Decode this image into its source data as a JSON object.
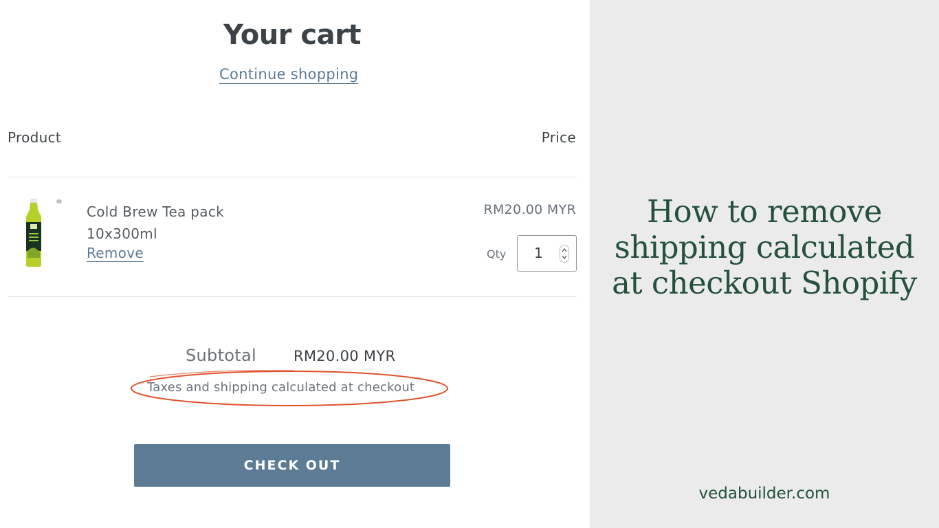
{
  "cart": {
    "title": "Your cart",
    "continue_label": "Continue shopping",
    "columns": {
      "product": "Product",
      "price": "Price"
    },
    "item": {
      "title_line1": "Cold Brew Tea pack",
      "title_line2": "10x300ml",
      "remove_label": "Remove",
      "price": "RM20.00 MYR",
      "qty_label": "Qty",
      "qty_value": "1"
    },
    "subtotal_label": "Subtotal",
    "subtotal_value": "RM20.00 MYR",
    "tax_note": "Taxes and shipping calculated at checkout",
    "checkout_label": "CHECK OUT"
  },
  "side": {
    "headline_line1": "How to remove",
    "headline_line2": "shipping calculated",
    "headline_line3": "at checkout Shopify",
    "site": "vedabuilder.com"
  },
  "colors": {
    "accent": "#5c7c96",
    "headline": "#24503c",
    "highlight_circle": "#e0522c",
    "side_bg": "#ebebeb"
  },
  "icons": [
    "product-thumbnail",
    "quantity-stepper-arrows"
  ]
}
